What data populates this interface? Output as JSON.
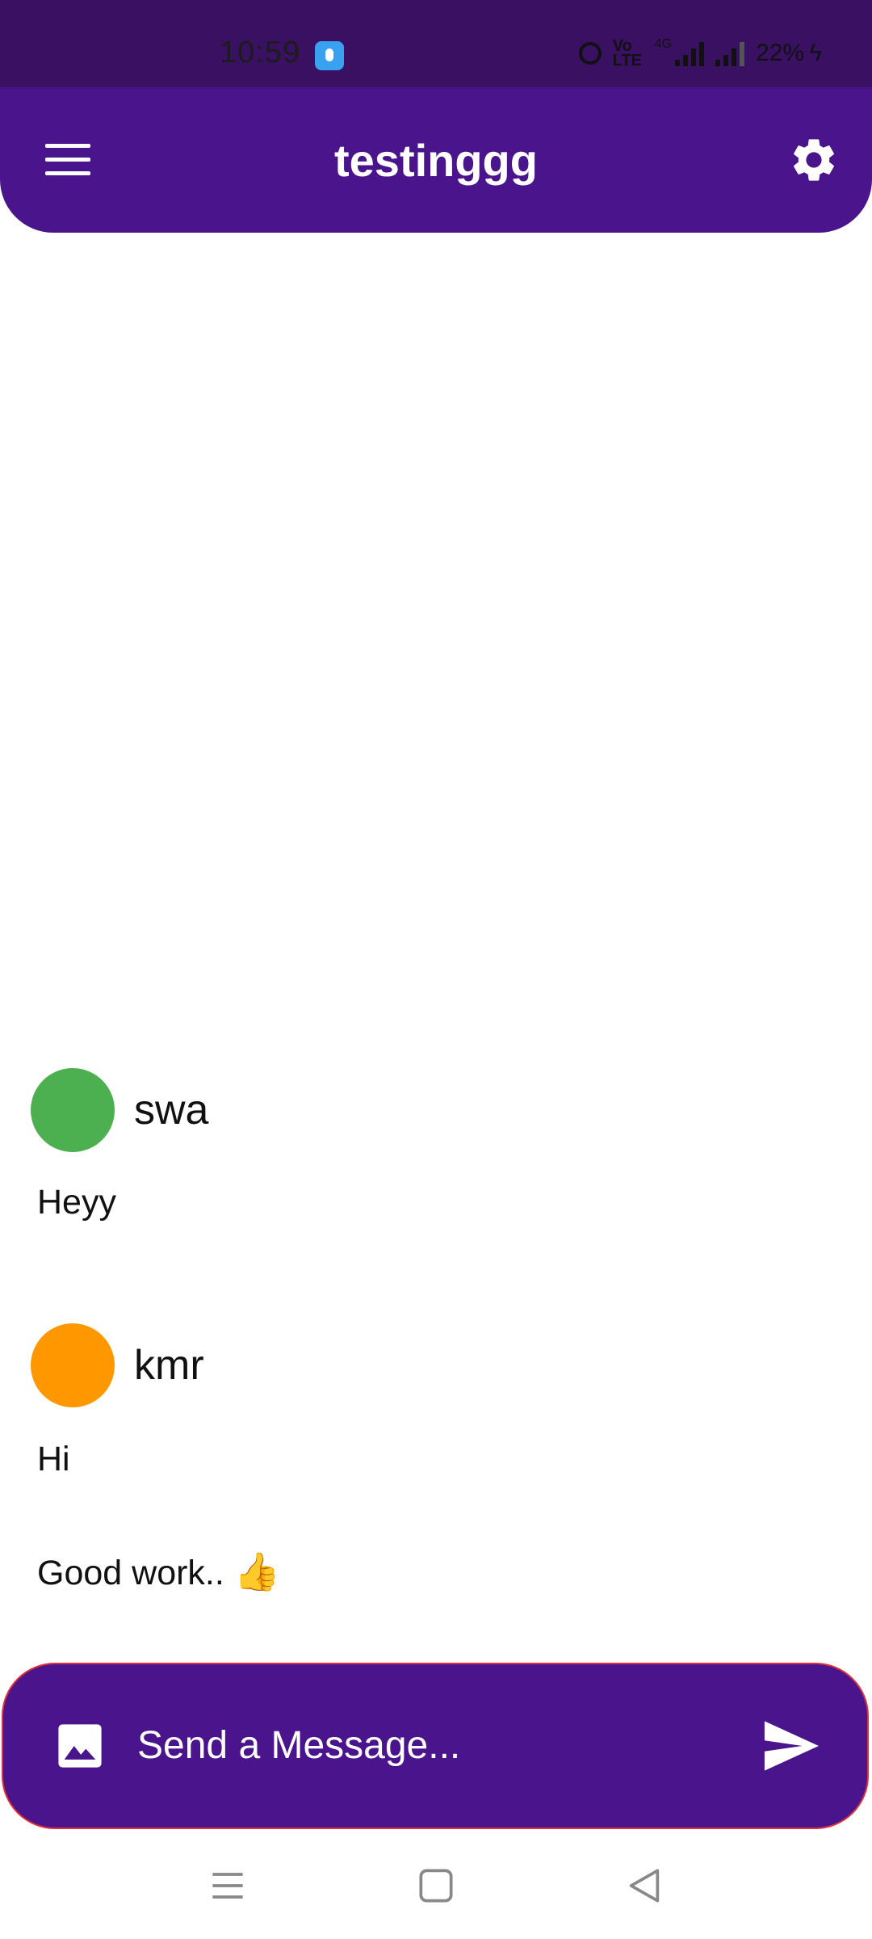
{
  "status_bar": {
    "time": "10:59",
    "volte_label": "Vo LTE",
    "network_label": "4G",
    "battery": "22%",
    "icons": [
      "app-notification-icon",
      "alarm-icon",
      "volte-icon",
      "signal-icon",
      "charging-icon"
    ]
  },
  "app_bar": {
    "title": "testinggg",
    "menu_icon": "hamburger-menu-icon",
    "settings_icon": "gear-icon"
  },
  "messages": [
    {
      "sender": "swa",
      "avatar_color": "#4caf50",
      "texts": [
        "Heyy"
      ]
    },
    {
      "sender": "kmr",
      "avatar_color": "#ff9800",
      "texts": [
        "Hi",
        "Good work.."
      ],
      "trailing_emoji": "👍"
    }
  ],
  "input_bar": {
    "placeholder": "Send a Message...",
    "image_icon": "image-icon",
    "send_icon": "send-icon",
    "background": "#4a148c",
    "border_color": "#e0303a"
  },
  "nav_bar": {
    "icons": [
      "recent-apps-icon",
      "home-icon",
      "back-icon"
    ]
  },
  "colors": {
    "status_bar": "#3a1062",
    "app_bar": "#4a148c",
    "text_on_primary": "#ffffff"
  }
}
